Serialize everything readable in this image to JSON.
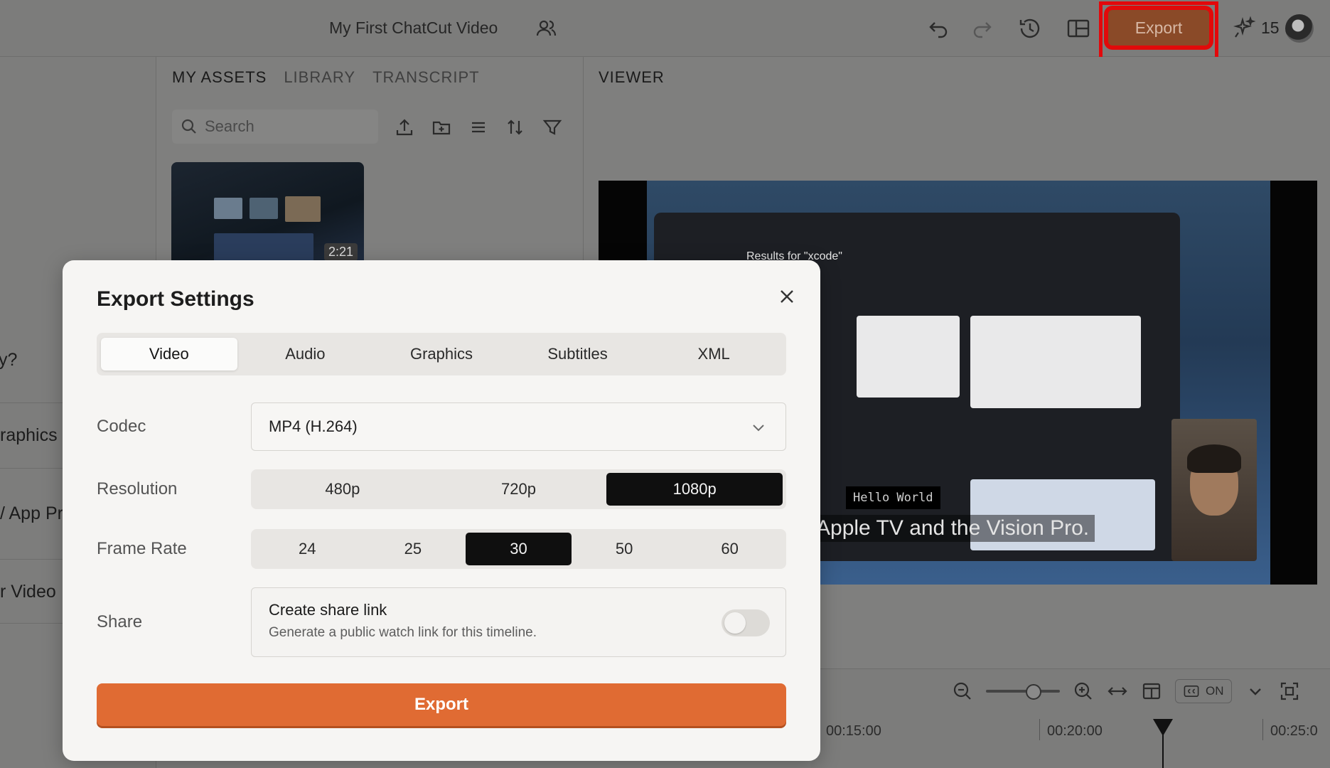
{
  "header": {
    "project_title": "My First ChatCut Video",
    "export_label": "Export",
    "credits": "15"
  },
  "left_rail": {
    "items": [
      "y?",
      "raphics",
      "/ App Pr",
      "r Video"
    ]
  },
  "assets": {
    "tabs": [
      "MY ASSETS",
      "LIBRARY",
      "TRANSCRIPT"
    ],
    "active_tab": "MY ASSETS",
    "search_placeholder": "Search",
    "thumbnail_duration": "2:21"
  },
  "viewer": {
    "title": "VIEWER",
    "results_text": "Results for \"xcode\"",
    "hello_text": "Hello World",
    "subtitle_text": "Apple TV and the Vision Pro."
  },
  "timeline": {
    "cc_label": "ON",
    "times": [
      "00:15:00",
      "00:20:00",
      "00:25:0"
    ]
  },
  "modal": {
    "title": "Export Settings",
    "tabs": [
      "Video",
      "Audio",
      "Graphics",
      "Subtitles",
      "XML"
    ],
    "active_tab": "Video",
    "codec": {
      "label": "Codec",
      "value": "MP4 (H.264)"
    },
    "resolution": {
      "label": "Resolution",
      "options": [
        "480p",
        "720p",
        "1080p"
      ],
      "selected": "1080p"
    },
    "frame_rate": {
      "label": "Frame Rate",
      "options": [
        "24",
        "25",
        "30",
        "50",
        "60"
      ],
      "selected": "30"
    },
    "share": {
      "label": "Share",
      "title": "Create share link",
      "description": "Generate a public watch link for this timeline.",
      "enabled": false
    },
    "export_button": "Export"
  },
  "colors": {
    "accent": "#e06b33",
    "highlight": "#e3080b",
    "selected_segment": "#0f0f0f"
  }
}
